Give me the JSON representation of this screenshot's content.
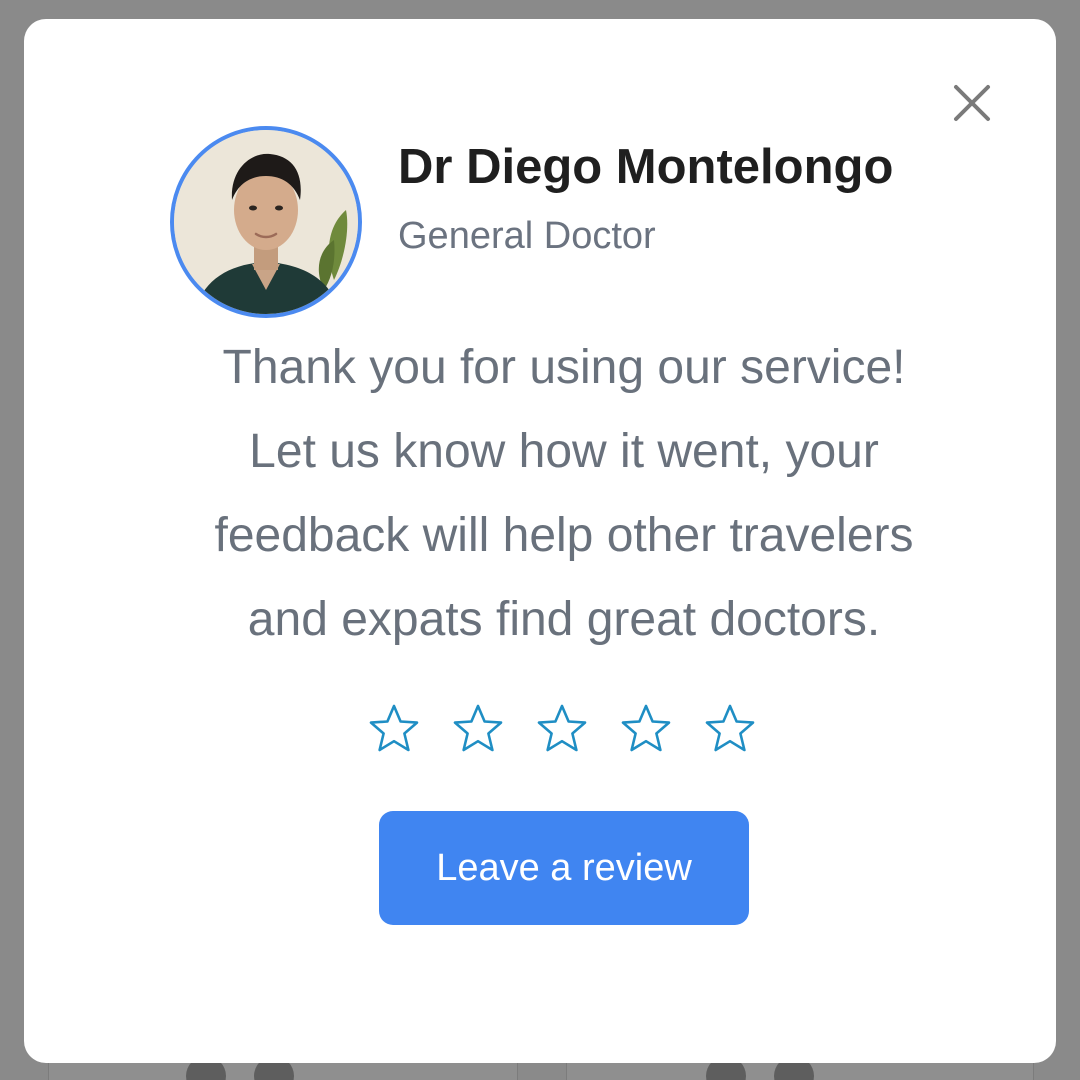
{
  "dialog": {
    "close_icon": "close-icon",
    "doctor": {
      "name": "Dr Diego Montelongo",
      "specialty": "General Doctor",
      "avatar_ring_color": "#4b8af0"
    },
    "message_lines": [
      "Thank you for using our service!",
      "Let us know how it went, your",
      "feedback will help other travelers",
      "and expats find great doctors."
    ],
    "rating": {
      "max": 5,
      "selected": 0,
      "star_icon": "star-outline-icon",
      "star_color": "#1f8ec4"
    },
    "button": {
      "label": "Leave a review",
      "color": "#4085f1"
    }
  }
}
